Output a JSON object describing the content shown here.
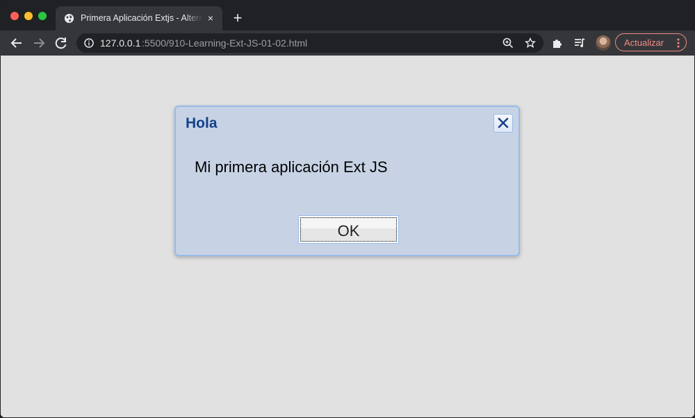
{
  "window": {
    "controls": [
      "close",
      "minimize",
      "zoom"
    ]
  },
  "tab": {
    "title": "Primera Aplicación Extjs - Alternativa",
    "icon": "globe-icon",
    "close": "×"
  },
  "newtab": {
    "label": "+"
  },
  "toolbar": {
    "back_icon": "arrow-left-icon",
    "forward_icon": "arrow-right-icon",
    "reload_icon": "reload-icon",
    "url_host": "127.0.0.1",
    "url_path": ":5500/910-Learning-Ext-JS-01-02.html",
    "zoom_icon": "zoom-icon",
    "bookmark_icon": "star-icon",
    "extensions_icon": "puzzle-icon",
    "media_icon": "media-control-icon",
    "update_label": "Actualizar",
    "colors": {
      "update": "#f28b82",
      "toolbar": "#35363a",
      "tabstrip": "#202124"
    }
  },
  "dialog": {
    "title": "Hola",
    "message": "Mi primera aplicación Ext JS",
    "ok_label": "OK",
    "colors": {
      "title": "#15428b",
      "body": "#c7d3e5",
      "border": "#99bbe8"
    }
  }
}
